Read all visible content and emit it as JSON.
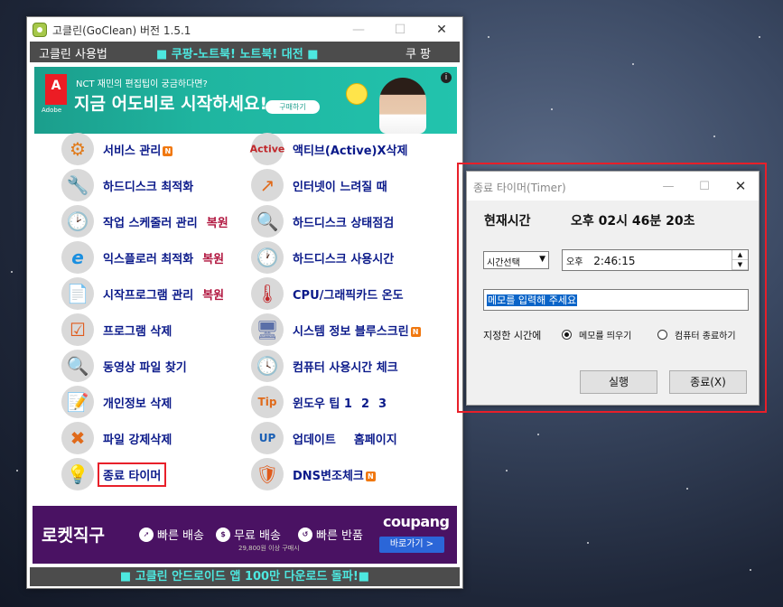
{
  "main_window": {
    "title": "고클린(GoClean) 버전 1.5.1",
    "menubar": {
      "left": "고클린 사용법",
      "center": "■ 쿠팡-노트북! 노트북! 대전 ■",
      "right": "쿠 팡"
    },
    "banner_top": {
      "logo": "A",
      "logo_sub": "Adobe",
      "subtitle": "NCT 재민의 편집팁이 궁금하다면?",
      "headline": "지금 어도비로 시작하세요!",
      "button": "구매하기",
      "info": "i"
    },
    "left_items": [
      {
        "label": "서비스 관리",
        "badge": "N",
        "restore": ""
      },
      {
        "label": "하드디스크 최적화",
        "badge": "",
        "restore": ""
      },
      {
        "label": "작업 스케줄러 관리",
        "badge": "",
        "restore": "복원"
      },
      {
        "label": "익스플로러 최적화",
        "badge": "",
        "restore": "복원"
      },
      {
        "label": "시작프로그램 관리",
        "badge": "",
        "restore": "복원"
      },
      {
        "label": "프로그램 삭제",
        "badge": "",
        "restore": ""
      },
      {
        "label": "동영상 파일 찾기",
        "badge": "",
        "restore": ""
      },
      {
        "label": "개인정보 삭제",
        "badge": "",
        "restore": ""
      },
      {
        "label": "파일 강제삭제",
        "badge": "",
        "restore": ""
      },
      {
        "label": "종료 타이머",
        "badge": "",
        "restore": ""
      }
    ],
    "right_items": [
      {
        "label": "액티브(Active)X삭제",
        "badge": "",
        "extra": ""
      },
      {
        "label": "인터넷이 느려질 때",
        "badge": "",
        "extra": ""
      },
      {
        "label": "하드디스크 상태점검",
        "badge": "",
        "extra": ""
      },
      {
        "label": "하드디스크 사용시간",
        "badge": "",
        "extra": ""
      },
      {
        "label": "CPU/그래픽카드 온도",
        "badge": "",
        "extra": ""
      },
      {
        "label": "시스템 정보 블루스크린",
        "badge": "N",
        "extra": ""
      },
      {
        "label": "컴퓨터 사용시간 체크",
        "badge": "",
        "extra": ""
      },
      {
        "label": "윈도우 팁 1",
        "badge": "",
        "extra": "2",
        "extra2": "3"
      },
      {
        "label": "업데이트",
        "badge": "",
        "extra": "홈페이지"
      },
      {
        "label": "DNS변조체크",
        "badge": "N",
        "extra": ""
      }
    ],
    "banner_bottom": {
      "rocket": "로켓직구",
      "b1": "빠른 배송",
      "b2": "무료 배송",
      "b3": "빠른 반품",
      "tiny": "29,800원 이상 구매시",
      "brand": "coupang",
      "go": "바로가기 >"
    },
    "footer": "■ 고클린 안드로이드 앱 100만 다운로드 돌파!■"
  },
  "timer_window": {
    "title": "종료 타이머(Timer)",
    "now_label": "현재시간",
    "now_value": "오후 02시 46분 20초",
    "select_value": "시간선택",
    "time_ampm": "오후",
    "time_value": "2:46:15",
    "memo_placeholder": "메모를 입력해 주세요",
    "at_time_label": "지정한 시간에",
    "radio_memo": "메모를 띄우기",
    "radio_shutdown": "컴퓨터 종료하기",
    "run_button": "실행",
    "exit_button": "종료(X)"
  },
  "colors": {
    "menubar": "#4c4c4c",
    "accent_cyan": "#4de8e0",
    "label_blue": "#0b1a8a",
    "restore_red": "#b1163f",
    "highlight_red": "#e8202a",
    "selection_blue": "#0a64c8"
  }
}
